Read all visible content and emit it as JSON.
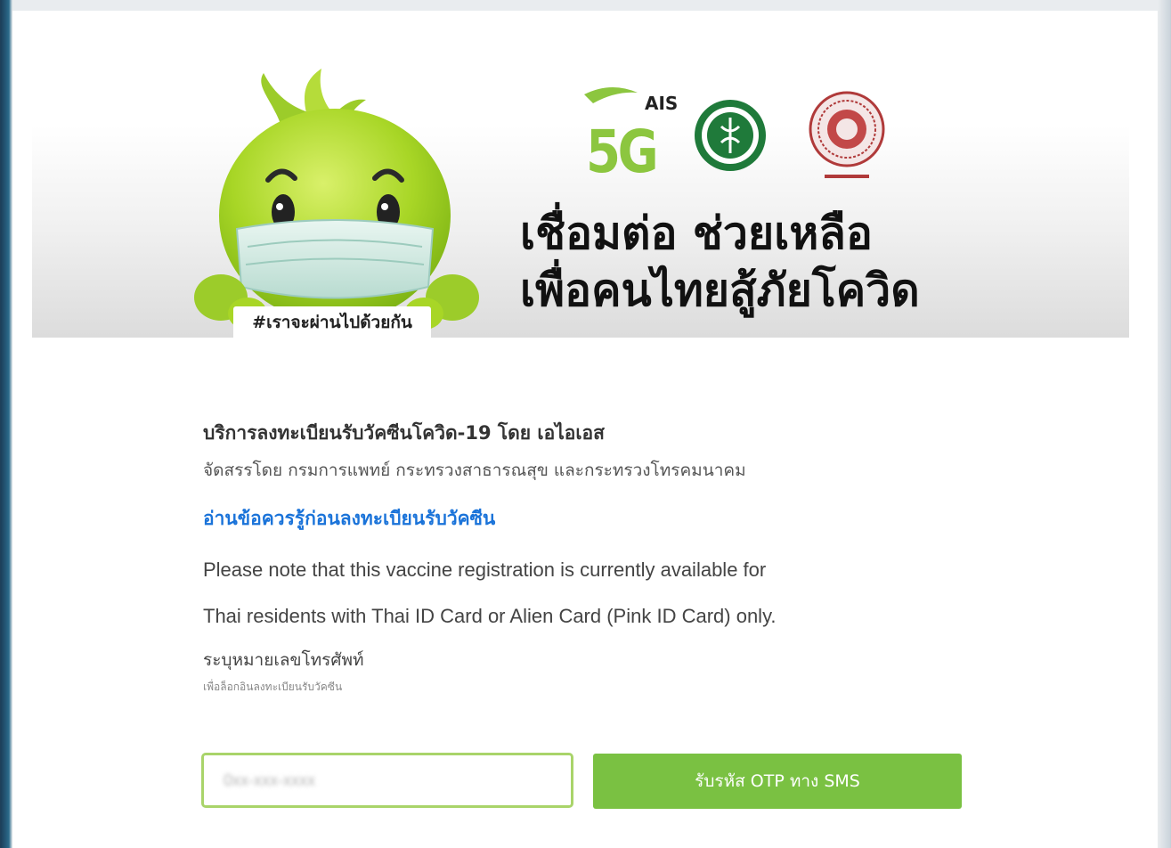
{
  "banner": {
    "hashtag": "#เราจะผ่านไปด้วยกัน",
    "brand": {
      "name": "AIS",
      "tech": "5G",
      "color": "#8cc63f"
    },
    "headline_line1": "เชื่อมต่อ ช่วยเหลือ",
    "headline_line2": "เพื่อคนไทยสู้ภัยโควิด",
    "logos": [
      "ais-5g-logo",
      "ministry-of-public-health-seal",
      "government-seal"
    ]
  },
  "service": {
    "title": "บริการลงทะเบียนรับวัคซีนโควิด-19 โดย เอไอเอส",
    "organizer": "จัดสรรโดย กรมการแพทย์ กระทรวงสาธารณสุข และกระทรวงโทรคมนาคม",
    "read_link": "อ่านข้อควรรู้ก่อนลงทะเบียนรับวัคซีน",
    "notice_line1": "Please note that this vaccine registration is currently available for",
    "notice_line2": "Thai residents with Thai ID Card or Alien Card (Pink ID Card) only."
  },
  "form": {
    "phone_label": "ระบุหมายเลขโทรศัพท์",
    "phone_hint": "เพื่อล็อกอินลงทะเบียนรับวัคซีน",
    "phone_placeholder": "0xx-xxx-xxxx",
    "otp_button": "รับรหัส OTP ทาง SMS"
  },
  "colors": {
    "accent_green": "#7ac142",
    "link_blue": "#1a73d9",
    "input_border": "#a9d46a"
  }
}
